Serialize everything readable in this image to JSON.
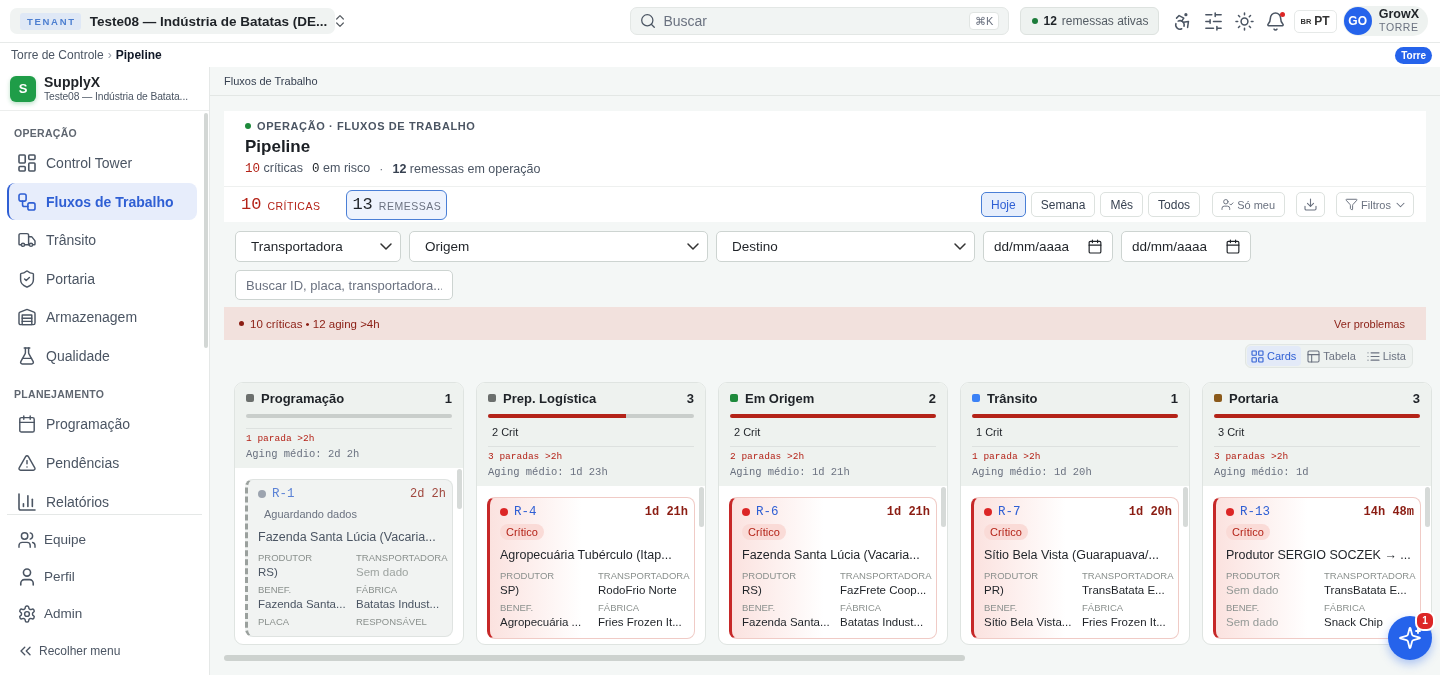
{
  "top_bar": {
    "tenant": {
      "badge": "TENANT",
      "name": "Teste08 — Indústria de Batatas (DE..."
    },
    "search": {
      "placeholder": "Buscar",
      "shortcut": "⌘K"
    },
    "active_shipments": {
      "count": "12",
      "label": "remessas ativas"
    },
    "notifications": {
      "unread": true
    },
    "language": {
      "region": "BR",
      "code": "PT"
    },
    "user": {
      "initials": "GO",
      "name": "GrowX",
      "role": "TORRE"
    }
  },
  "breadcrumb": {
    "items": [
      {
        "label": "Torre de Controle",
        "current": false
      },
      {
        "label": "Pipeline",
        "current": true
      }
    ],
    "separator": "›",
    "badge": "Torre"
  },
  "sidebar": {
    "brand": {
      "logo": "S",
      "name": "SupplyX",
      "subtitle": "Teste08 — Indústria de Batata..."
    },
    "sections": [
      {
        "title": "OPERAÇÃO",
        "items": [
          {
            "label": "Control Tower",
            "selected": false
          },
          {
            "label": "Fluxos de Trabalho",
            "selected": true
          },
          {
            "label": "Trânsito",
            "selected": false
          },
          {
            "label": "Portaria",
            "selected": false
          },
          {
            "label": "Armazenagem",
            "selected": false
          },
          {
            "label": "Qualidade",
            "selected": false
          }
        ]
      },
      {
        "title": "PLANEJAMENTO",
        "items": [
          {
            "label": "Programação",
            "selected": false
          },
          {
            "label": "Pendências",
            "selected": false
          },
          {
            "label": "Relatórios",
            "selected": false
          }
        ]
      }
    ],
    "footer_items": [
      {
        "label": "Equipe",
        "selected": false
      },
      {
        "label": "Perfil",
        "selected": false
      },
      {
        "label": "Admin",
        "selected": false
      }
    ],
    "collapse": "Recolher menu"
  },
  "page": {
    "section_title": "Fluxos de Trabalho",
    "eyebrow": "OPERAÇÃO · FLUXOS DE TRABALHO",
    "title": "Pipeline",
    "summary": {
      "critical": {
        "value": "10",
        "label": "críticas"
      },
      "risk": {
        "value": "0",
        "label": "em risco"
      },
      "separator": "·",
      "total": {
        "value": "12",
        "label": "remessas em operação"
      }
    }
  },
  "toolbar": {
    "kpis": [
      {
        "kind": "critical",
        "value": "10",
        "label": "CRÍTICAS",
        "selected": false
      },
      {
        "kind": "total",
        "value": "13",
        "label": "REMESSAS",
        "selected": true
      }
    ],
    "periods": [
      {
        "label": "Hoje",
        "selected": true
      },
      {
        "label": "Semana",
        "selected": false
      },
      {
        "label": "Mês",
        "selected": false
      },
      {
        "label": "Todos",
        "selected": false
      }
    ],
    "only_mine": "Só meu",
    "filters_button": "Filtros"
  },
  "filters": {
    "dropdowns": [
      {
        "label": "Transportadora"
      },
      {
        "label": "Origem"
      },
      {
        "label": "Destino"
      }
    ],
    "dates": [
      {
        "placeholder": "dd/mm/aaaa"
      },
      {
        "placeholder": "dd/mm/aaaa"
      }
    ],
    "search": {
      "placeholder": "Buscar ID, placa, transportadora..."
    }
  },
  "alert": {
    "text": "10 críticas • 12 aging >4h",
    "action": "Ver problemas"
  },
  "view_modes": [
    {
      "label": "Cards",
      "selected": true
    },
    {
      "label": "Tabela",
      "selected": false
    },
    {
      "label": "Lista",
      "selected": false
    }
  ],
  "board": {
    "columns": [
      {
        "name": "Programação",
        "color": "#6b6f6d",
        "count": "1",
        "stalled": "1 parada >2h",
        "aging": "Aging médio: 2d 2h",
        "cards": [
          {
            "kind": "waiting",
            "id": "R-1",
            "time": "2d 2h",
            "tag": "Aguardando dados",
            "title": "Fazenda Santa Lúcia (Vacaria...",
            "fields": [
              {
                "label": "PRODUTOR",
                "value": "RS)",
                "muted": false
              },
              {
                "label": "TRANSPORTADORA",
                "value": "Sem dado",
                "muted": true
              },
              {
                "label": "BENEF.",
                "value": "Fazenda Santa...",
                "muted": false
              },
              {
                "label": "FÁBRICA",
                "value": "Batatas Indust...",
                "muted": false
              },
              {
                "label": "PLACA"
              },
              {
                "label": "RESPONSÁVEL"
              }
            ]
          }
        ]
      },
      {
        "name": "Prep. Logística",
        "color": "#6b6f6d",
        "count": "3",
        "level": 0.67,
        "critical": "2 Crit",
        "stalled": "3 paradas >2h",
        "aging": "Aging médio: 1d 23h",
        "cards": [
          {
            "kind": "critical",
            "id": "R-4",
            "time": "1d 21h",
            "tag": "Crítico",
            "title": "Agropecuária Tubérculo (Itap...",
            "fields": [
              {
                "label": "PRODUTOR",
                "value": "SP)",
                "muted": false
              },
              {
                "label": "TRANSPORTADORA",
                "value": "RodoFrio Norte",
                "muted": false
              },
              {
                "label": "BENEF.",
                "value": "Agropecuária ...",
                "muted": false
              },
              {
                "label": "FÁBRICA",
                "value": "Fries Frozen It...",
                "muted": false
              }
            ]
          }
        ]
      },
      {
        "name": "Em Origem",
        "color": "#1e8a3c",
        "count": "2",
        "level": 1,
        "critical": "2 Crit",
        "stalled": "2 paradas >2h",
        "aging": "Aging médio: 1d 21h",
        "cards": [
          {
            "kind": "critical",
            "id": "R-6",
            "time": "1d 21h",
            "tag": "Crítico",
            "title": "Fazenda Santa Lúcia (Vacaria...",
            "fields": [
              {
                "label": "PRODUTOR",
                "value": "RS)",
                "muted": false
              },
              {
                "label": "TRANSPORTADORA",
                "value": "FazFrete Coop...",
                "muted": false
              },
              {
                "label": "BENEF.",
                "value": "Fazenda Santa...",
                "muted": false
              },
              {
                "label": "FÁBRICA",
                "value": "Batatas Indust...",
                "muted": false
              }
            ]
          }
        ]
      },
      {
        "name": "Trânsito",
        "color": "#3b82f6",
        "count": "1",
        "level": 1,
        "critical": "1 Crit",
        "stalled": "1 parada >2h",
        "aging": "Aging médio: 1d 20h",
        "cards": [
          {
            "kind": "critical",
            "id": "R-7",
            "time": "1d 20h",
            "tag": "Crítico",
            "title": "Sítio Bela Vista (Guarapuava/...",
            "fields": [
              {
                "label": "PRODUTOR",
                "value": "PR)",
                "muted": false
              },
              {
                "label": "TRANSPORTADORA",
                "value": "TransBatata E...",
                "muted": false
              },
              {
                "label": "BENEF.",
                "value": "Sítio Bela Vista...",
                "muted": false
              },
              {
                "label": "FÁBRICA",
                "value": "Fries Frozen It...",
                "muted": false
              }
            ]
          }
        ]
      },
      {
        "name": "Portaria",
        "color": "#8b5a1b",
        "count": "3",
        "level": 1,
        "critical": "3 Crit",
        "stalled": "3 paradas >2h",
        "aging": "Aging médio: 1d",
        "cards": [
          {
            "kind": "critical",
            "id": "R-13",
            "time": "14h 48m",
            "tag": "Crítico",
            "title": "Produtor SERGIO SOCZEK → ...",
            "fields": [
              {
                "label": "PRODUTOR",
                "value": "Sem dado",
                "muted": true
              },
              {
                "label": "TRANSPORTADORA",
                "value": "TransBatata E...",
                "muted": false
              },
              {
                "label": "BENEF.",
                "value": "Sem dado",
                "muted": true
              },
              {
                "label": "FÁBRICA",
                "value": "Snack Chip",
                "muted": false
              }
            ]
          }
        ]
      }
    ]
  },
  "assistant": {
    "badge": "1"
  }
}
